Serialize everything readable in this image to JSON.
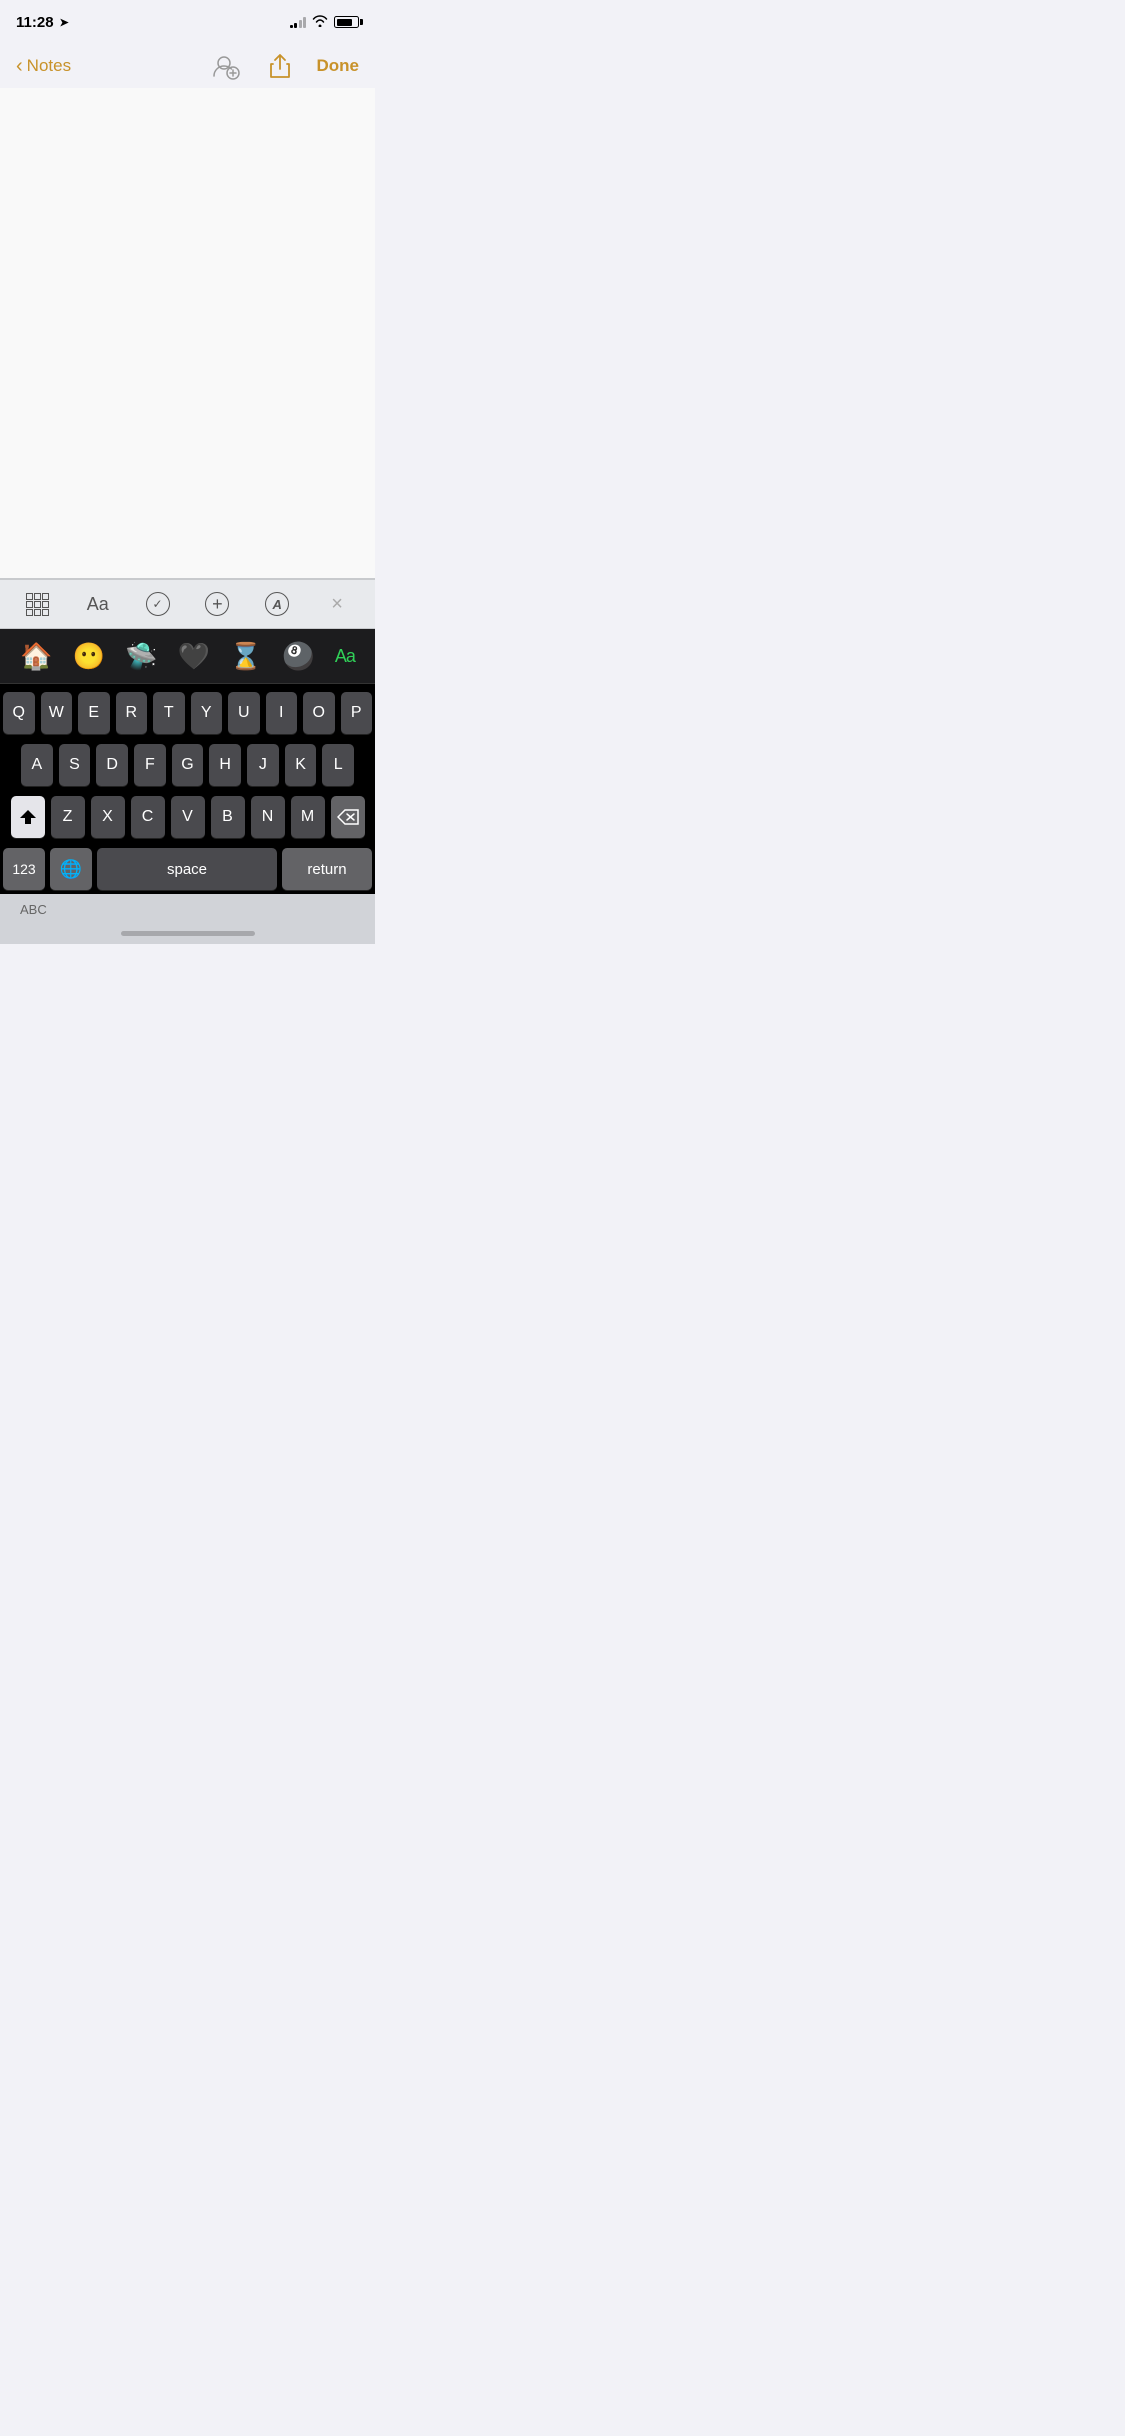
{
  "statusBar": {
    "time": "11:28",
    "locationArrow": "▲"
  },
  "navBar": {
    "backLabel": "Notes",
    "doneLabel": "Done"
  },
  "toolbar": {
    "tableLabel": "table",
    "fontLabel": "Aa",
    "checkLabel": "✓",
    "addLabel": "+",
    "penLabel": "A",
    "closeLabel": "×"
  },
  "emojiRow": {
    "items": [
      "🏠",
      "😶",
      "🛸",
      "🖤",
      "⌛",
      "🎱"
    ],
    "aaLabel": "Aa"
  },
  "keyboard": {
    "row1": [
      "Q",
      "W",
      "E",
      "R",
      "T",
      "Y",
      "U",
      "I",
      "O",
      "P"
    ],
    "row2": [
      "A",
      "S",
      "D",
      "F",
      "G",
      "H",
      "J",
      "K",
      "L"
    ],
    "row3": [
      "Z",
      "X",
      "C",
      "V",
      "B",
      "N",
      "M"
    ],
    "numbersLabel": "123",
    "spaceLabel": "space",
    "returnLabel": "return"
  },
  "bottomBar": {
    "abcLabel": "ABC"
  }
}
